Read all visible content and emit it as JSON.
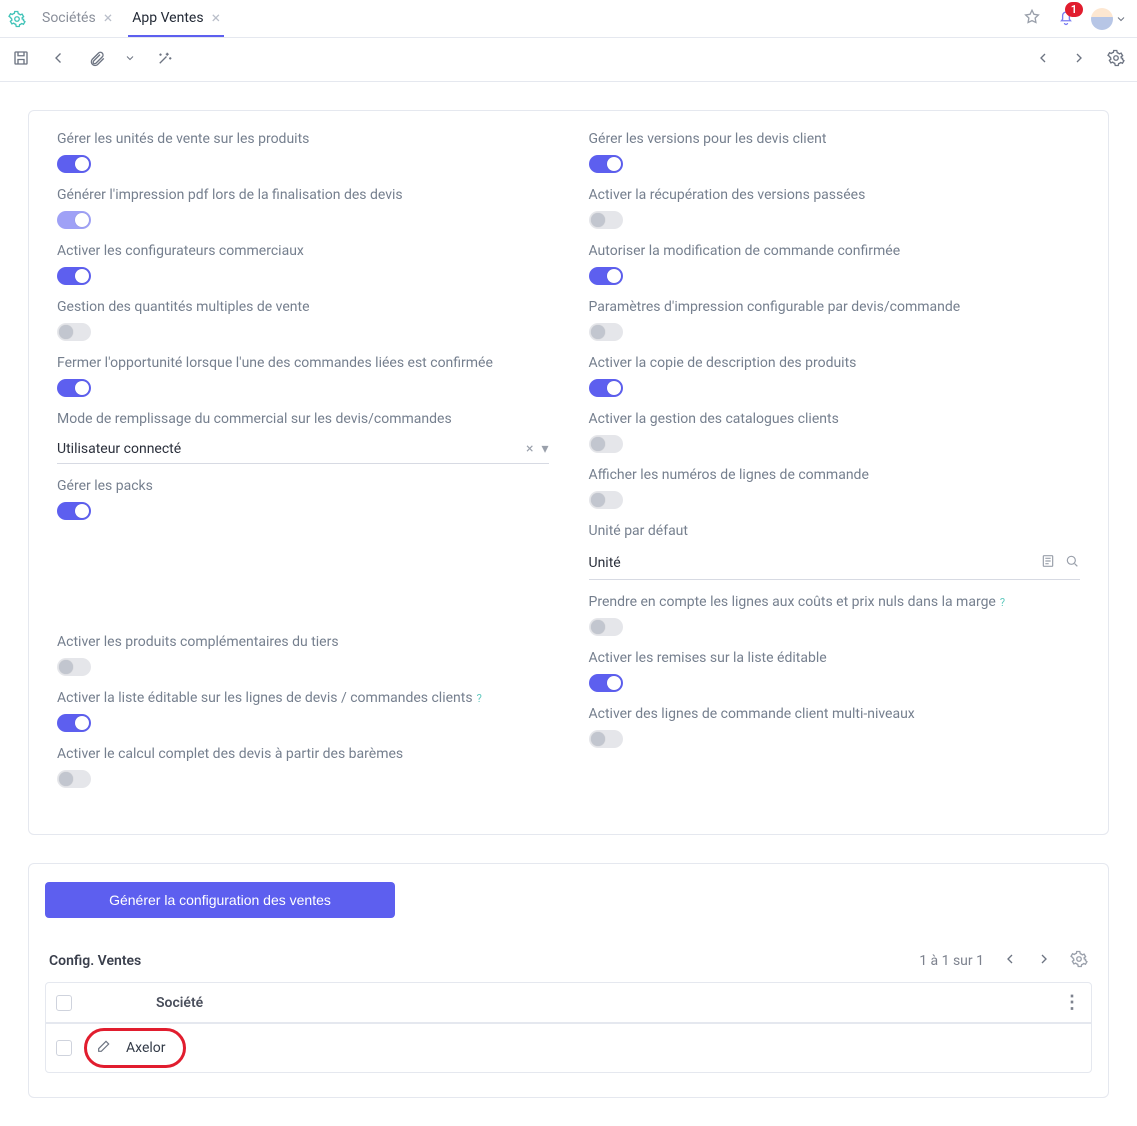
{
  "tabs": [
    {
      "label": "Sociétés",
      "active": false
    },
    {
      "label": "App Ventes",
      "active": true
    }
  ],
  "notifications": {
    "count": "1"
  },
  "settings": {
    "left": [
      {
        "key": "manage_sale_units",
        "label": "Gérer les unités de vente sur les produits",
        "value": true
      },
      {
        "key": "pdf_on_finalize",
        "label": "Générer l'impression pdf lors de la finalisation des devis",
        "value": true,
        "soft": true
      },
      {
        "key": "enable_configurators",
        "label": "Activer les configurateurs commerciaux",
        "value": true
      },
      {
        "key": "multi_qty",
        "label": "Gestion des quantités multiples de vente",
        "value": false
      },
      {
        "key": "close_opportunity",
        "label": "Fermer l'opportunité lorsque l'une des commandes liées est confirmée",
        "value": true
      },
      {
        "key": "fill_mode",
        "label": "Mode de remplissage du commercial sur les devis/commandes",
        "type": "select",
        "selectValue": "Utilisateur connecté"
      },
      {
        "key": "manage_packs",
        "label": "Gérer les packs",
        "value": true
      },
      {
        "key": "spacer1",
        "type": "spacer"
      },
      {
        "key": "complementary_products",
        "label": "Activer les produits complémentaires du tiers",
        "value": false
      },
      {
        "key": "editable_list",
        "label": "Activer la liste éditable sur les lignes de devis / commandes clients",
        "value": true,
        "help": true
      },
      {
        "key": "full_bareme_calc",
        "label": "Activer le calcul complet des devis à partir des barèmes",
        "value": false
      }
    ],
    "right": [
      {
        "key": "manage_versions",
        "label": "Gérer les versions pour les devis client",
        "value": true
      },
      {
        "key": "recover_past_versions",
        "label": "Activer la récupération des versions passées",
        "value": false
      },
      {
        "key": "allow_edit_confirmed",
        "label": "Autoriser la modification de commande confirmée",
        "value": true
      },
      {
        "key": "print_params",
        "label": "Paramètres d'impression configurable par devis/commande",
        "value": false
      },
      {
        "key": "copy_product_desc",
        "label": "Activer la copie de description des produits",
        "value": true
      },
      {
        "key": "client_catalogs",
        "label": "Activer la gestion des catalogues clients",
        "value": false
      },
      {
        "key": "show_line_numbers",
        "label": "Afficher les numéros de lignes de commande",
        "value": false
      },
      {
        "key": "default_unit",
        "label": "Unité par défaut",
        "type": "lookup",
        "selectValue": "Unité"
      },
      {
        "key": "zero_cost_margin",
        "label": "Prendre en compte les lignes aux coûts et prix nuls dans la marge",
        "value": false,
        "help": true
      },
      {
        "key": "discounts_editable",
        "label": "Activer les remises sur la liste éditable",
        "value": true
      },
      {
        "key": "multilevel_lines",
        "label": "Activer des lignes de commande client multi-niveaux",
        "value": false
      }
    ]
  },
  "generate_button": "Générer la configuration des ventes",
  "config_section": {
    "title": "Config. Ventes",
    "pager": "1 à 1 sur 1",
    "column_header": "Société",
    "rows": [
      {
        "company": "Axelor"
      }
    ]
  }
}
